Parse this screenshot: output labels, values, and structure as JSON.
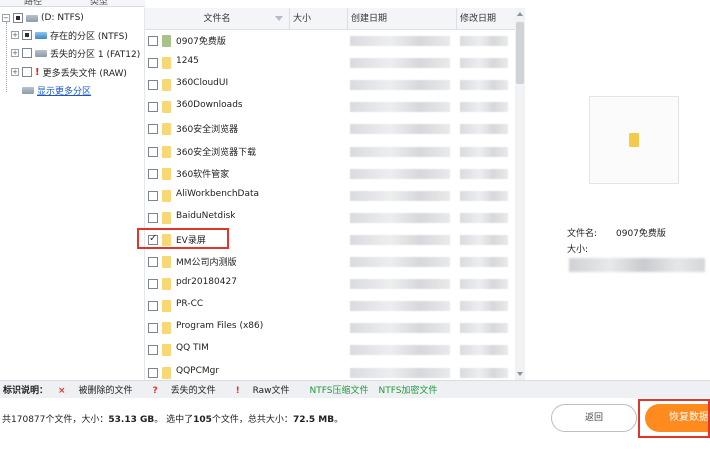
{
  "tabs": [
    "路径",
    "类型"
  ],
  "tree": {
    "root": "(D: NTFS)",
    "items": [
      {
        "label": "存在的分区 (NTFS)",
        "icon": "drive-blue-icon"
      },
      {
        "label": "丢失的分区 1 (FAT12)",
        "icon": "drive-gray-icon"
      },
      {
        "label": "更多丢失文件 (RAW)",
        "icon": "warning-icon"
      }
    ],
    "more_link": "显示更多分区"
  },
  "list": {
    "columns": [
      "文件名",
      "大小",
      "创建日期",
      "修改日期"
    ],
    "rows": [
      {
        "name": "0907免费版",
        "checked": false,
        "icon": "file-green"
      },
      {
        "name": "1245",
        "checked": false,
        "icon": "folder"
      },
      {
        "name": "360CloudUI",
        "checked": false,
        "icon": "folder"
      },
      {
        "name": "360Downloads",
        "checked": false,
        "icon": "folder"
      },
      {
        "name": "360安全浏览器",
        "checked": false,
        "icon": "folder"
      },
      {
        "name": "360安全浏览器下载",
        "checked": false,
        "icon": "folder"
      },
      {
        "name": "360软件管家",
        "checked": false,
        "icon": "folder"
      },
      {
        "name": "AliWorkbenchData",
        "checked": false,
        "icon": "folder"
      },
      {
        "name": "BaiduNetdisk",
        "checked": false,
        "icon": "folder"
      },
      {
        "name": "EV录屏",
        "checked": true,
        "icon": "folder"
      },
      {
        "name": "MM公司内测版",
        "checked": false,
        "icon": "folder"
      },
      {
        "name": "pdr20180427",
        "checked": false,
        "icon": "folder"
      },
      {
        "name": "PR-CC",
        "checked": false,
        "icon": "folder"
      },
      {
        "name": "Program Files (x86)",
        "checked": false,
        "icon": "folder"
      },
      {
        "name": "QQ TIM",
        "checked": false,
        "icon": "folder"
      },
      {
        "name": "QQPCMgr",
        "checked": false,
        "icon": "folder"
      }
    ]
  },
  "preview": {
    "filename_label": "文件名:",
    "filename_value": "0907免费版",
    "size_label": "大小:"
  },
  "legend": {
    "title": "标识说明：",
    "deleted": "被删除的文件",
    "lost": "丢失的文件",
    "raw": "Raw文件",
    "ntfs_compressed": "NTFS压缩文件",
    "ntfs_encrypted": "NTFS加密文件",
    "colors": {
      "red": "#e0352b",
      "green": "#1f9a3a"
    }
  },
  "status": {
    "prefix": "共",
    "total_files": "170877",
    "files_word": "个文件，大小：",
    "total_size": "53.13 GB",
    "selected_prefix": "。 选中了",
    "selected_count": "105",
    "selected_mid": "个文件，总共大小：",
    "selected_size": "72.5 MB",
    "suffix": "。"
  },
  "buttons": {
    "back": "返回",
    "recover": "恢复数据",
    "accent": "#ff8b1f"
  }
}
